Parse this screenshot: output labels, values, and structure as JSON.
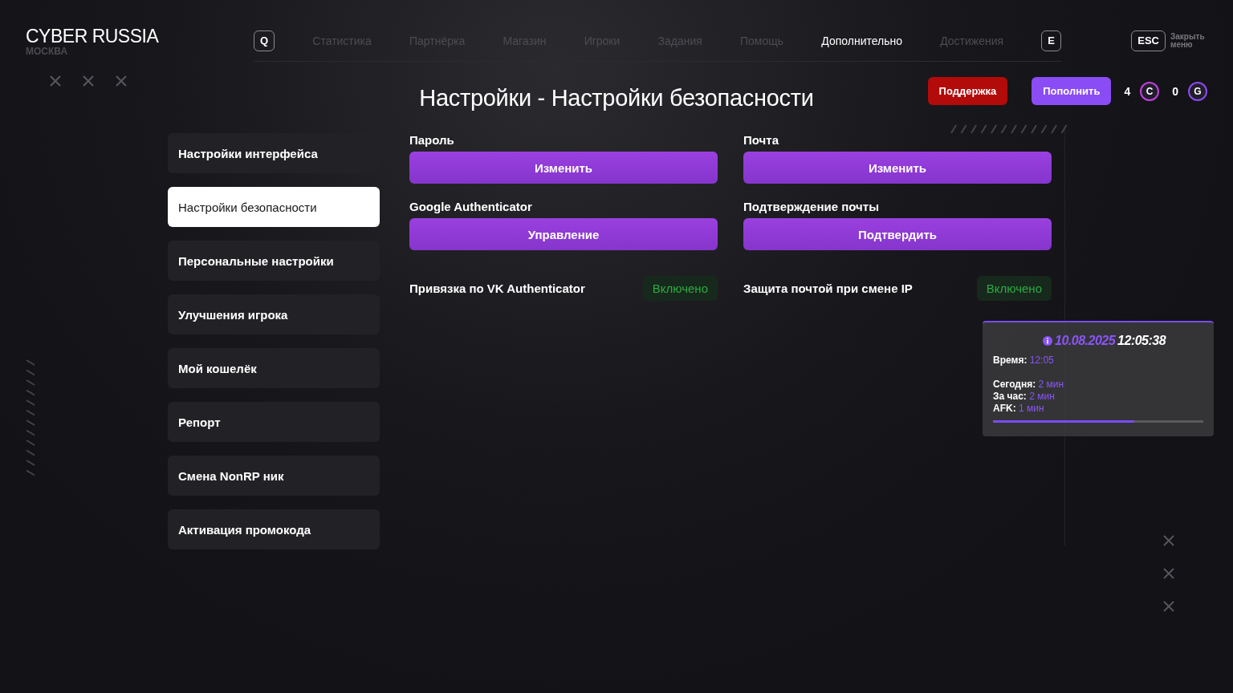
{
  "brand": {
    "title": "CYBER RUSSIA",
    "subtitle": "МОСКВА"
  },
  "nav": {
    "prev_key": "Q",
    "next_key": "E",
    "items": [
      {
        "label": "Статистика",
        "selected": false
      },
      {
        "label": "Партнёрка",
        "selected": false
      },
      {
        "label": "Магазин",
        "selected": false
      },
      {
        "label": "Игроки",
        "selected": false
      },
      {
        "label": "Задания",
        "selected": false
      },
      {
        "label": "Помощь",
        "selected": false
      },
      {
        "label": "Дополнительно",
        "selected": true
      },
      {
        "label": "Достижения",
        "selected": false
      }
    ]
  },
  "close": {
    "key": "ESC",
    "label": "Закрыть меню"
  },
  "page_title": "Настройки - Настройки безопасности",
  "actions": {
    "support": "Поддержка",
    "topup": "Пополнить"
  },
  "currencies": [
    {
      "amount": "4",
      "symbol": "C",
      "color": "#c040e0"
    },
    {
      "amount": "0",
      "symbol": "G",
      "color": "#8a4cf0"
    }
  ],
  "sidebar": [
    {
      "label": "Настройки интерфейса",
      "selected": false
    },
    {
      "label": "Настройки безопасности",
      "selected": true
    },
    {
      "label": "Персональные настройки",
      "selected": false
    },
    {
      "label": "Улучшения игрока",
      "selected": false
    },
    {
      "label": "Мой кошелёк",
      "selected": false
    },
    {
      "label": "Репорт",
      "selected": false
    },
    {
      "label": "Смена NonRP ник",
      "selected": false
    },
    {
      "label": "Активация промокода",
      "selected": false
    }
  ],
  "settings": [
    {
      "kind": "button",
      "label": "Пароль",
      "action": "Изменить"
    },
    {
      "kind": "button",
      "label": "Почта",
      "action": "Изменить"
    },
    {
      "kind": "button",
      "label": "Google Authenticator",
      "action": "Управление"
    },
    {
      "kind": "button",
      "label": "Подтверждение почты",
      "action": "Подтвердить"
    },
    {
      "kind": "status",
      "label": "Привязка по VK Authenticator",
      "status": "Включено"
    },
    {
      "kind": "status",
      "label": "Защита почтой при смене IP",
      "status": "Включено"
    }
  ],
  "session": {
    "date": "10.08.2025",
    "time": "12:05:38",
    "clock": [
      {
        "label": "Время:",
        "value": "12:05"
      }
    ],
    "stats": [
      {
        "label": "Сегодня:",
        "value": "2 мин"
      },
      {
        "label": "За час:",
        "value": "2 мин"
      },
      {
        "label": "AFK:",
        "value": "1 мин"
      }
    ],
    "level": 0.67
  }
}
